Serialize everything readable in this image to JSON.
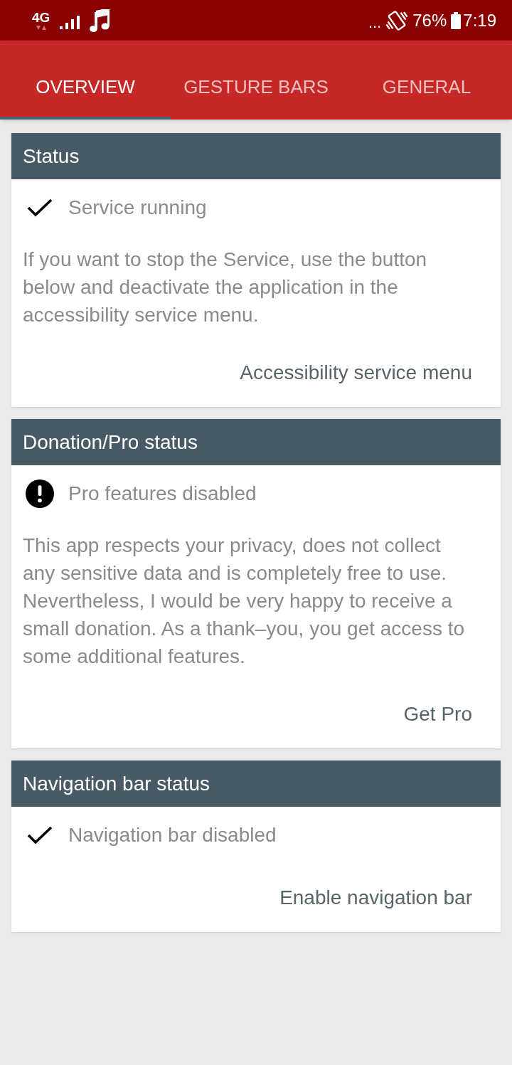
{
  "status_bar": {
    "network": "4G",
    "overflow": "...",
    "battery": "76%",
    "time": "7:19"
  },
  "tabs": [
    {
      "label": "OVERVIEW",
      "selected": true
    },
    {
      "label": "GESTURE BARS",
      "selected": false
    },
    {
      "label": "GENERAL",
      "selected": false
    }
  ],
  "cards": [
    {
      "title": "Status",
      "status": {
        "kind": "check",
        "text": "Service running"
      },
      "description": "If you want to stop the Service, use the button below and deactivate the application in the accessibility service menu.",
      "action": "Accessibility service menu"
    },
    {
      "title": "Donation/Pro status",
      "status": {
        "kind": "alert",
        "text": "Pro features disabled"
      },
      "description": "This app respects your privacy, does not collect any sensitive data and is completely free to use. Nevertheless, I would be very happy to receive a small donation. As a thank–you, you get access to some additional features.",
      "action": "Get Pro"
    },
    {
      "title": "Navigation bar status",
      "status": {
        "kind": "check",
        "text": "Navigation bar disabled"
      },
      "action": "Enable navigation bar"
    }
  ]
}
